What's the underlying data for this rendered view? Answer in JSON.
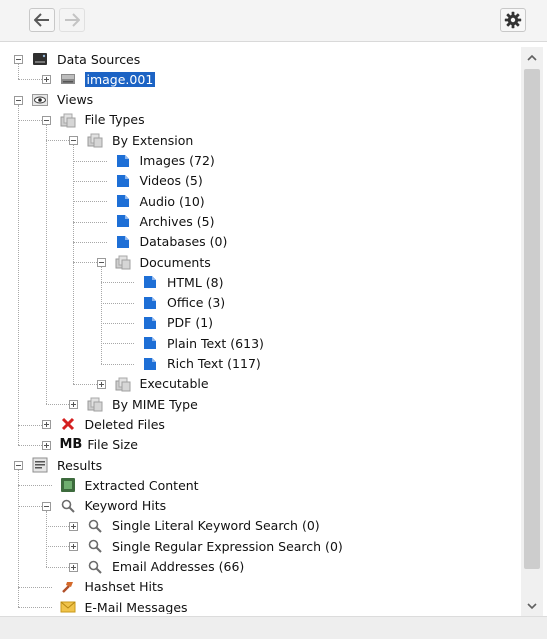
{
  "toolbar": {
    "back_icon": "arrow-left-icon",
    "forward_icon": "arrow-right-icon",
    "settings_icon": "gear-icon"
  },
  "tree": [
    {
      "id": "ds",
      "label": "Data Sources",
      "icon": "hdd-icon",
      "expander": "minus",
      "level": 0
    },
    {
      "id": "img",
      "label": "image.001",
      "icon": "disk-image-icon",
      "expander": "plus",
      "level": 1,
      "selected": true
    },
    {
      "id": "views",
      "label": "Views",
      "icon": "eye-icon",
      "expander": "minus",
      "level": 0
    },
    {
      "id": "ft",
      "label": "File Types",
      "icon": "file-types-icon",
      "expander": "minus",
      "level": 1
    },
    {
      "id": "byext",
      "label": "By Extension",
      "icon": "file-types-icon",
      "expander": "minus",
      "level": 2
    },
    {
      "id": "images",
      "label": "Images (72)",
      "icon": "folder-icon",
      "level": 3
    },
    {
      "id": "videos",
      "label": "Videos (5)",
      "icon": "folder-icon",
      "level": 3
    },
    {
      "id": "audio",
      "label": "Audio (10)",
      "icon": "folder-icon",
      "level": 3
    },
    {
      "id": "archives",
      "label": "Archives (5)",
      "icon": "folder-icon",
      "level": 3
    },
    {
      "id": "databases",
      "label": "Databases (0)",
      "icon": "folder-icon",
      "level": 3
    },
    {
      "id": "documents",
      "label": "Documents",
      "icon": "file-types-icon",
      "expander": "minus",
      "level": 3
    },
    {
      "id": "html",
      "label": "HTML (8)",
      "icon": "folder-icon",
      "level": 4
    },
    {
      "id": "office",
      "label": "Office (3)",
      "icon": "folder-icon",
      "level": 4
    },
    {
      "id": "pdf",
      "label": "PDF (1)",
      "icon": "folder-icon",
      "level": 4
    },
    {
      "id": "plaintext",
      "label": "Plain Text (613)",
      "icon": "folder-icon",
      "level": 4
    },
    {
      "id": "richtext",
      "label": "Rich Text (117)",
      "icon": "folder-icon",
      "level": 4
    },
    {
      "id": "exec",
      "label": "Executable",
      "icon": "file-types-icon",
      "expander": "plus",
      "level": 3
    },
    {
      "id": "mime",
      "label": "By MIME Type",
      "icon": "file-types-icon",
      "expander": "plus",
      "level": 2
    },
    {
      "id": "deleted",
      "label": "Deleted Files",
      "icon": "deleted-x-icon",
      "expander": "plus",
      "level": 1
    },
    {
      "id": "filesize",
      "label": "File Size",
      "icon": "mb-icon",
      "icon_text": "MB",
      "expander": "plus",
      "level": 1
    },
    {
      "id": "results",
      "label": "Results",
      "icon": "results-icon",
      "expander": "minus",
      "level": 0
    },
    {
      "id": "extracted",
      "label": "Extracted Content",
      "icon": "extracted-content-icon",
      "level": 1
    },
    {
      "id": "kwhits",
      "label": "Keyword Hits",
      "icon": "magnifier-icon",
      "expander": "minus",
      "level": 1
    },
    {
      "id": "kw1",
      "label": "Single Literal Keyword Search (0)",
      "icon": "magnifier-icon",
      "expander": "plus",
      "level": 2
    },
    {
      "id": "kw2",
      "label": "Single Regular Expression Search (0)",
      "icon": "magnifier-icon",
      "expander": "plus",
      "level": 2
    },
    {
      "id": "kw3",
      "label": "Email Addresses (66)",
      "icon": "magnifier-icon",
      "expander": "plus",
      "level": 2
    },
    {
      "id": "hashset",
      "label": "Hashset Hits",
      "icon": "hashset-icon",
      "level": 1
    },
    {
      "id": "email",
      "label": "E-Mail Messages",
      "icon": "envelope-icon",
      "level": 1
    }
  ],
  "colors": {
    "selection": "#1c63c4",
    "folder_blue": "#1e6fd6",
    "deleted_red": "#d42020"
  }
}
